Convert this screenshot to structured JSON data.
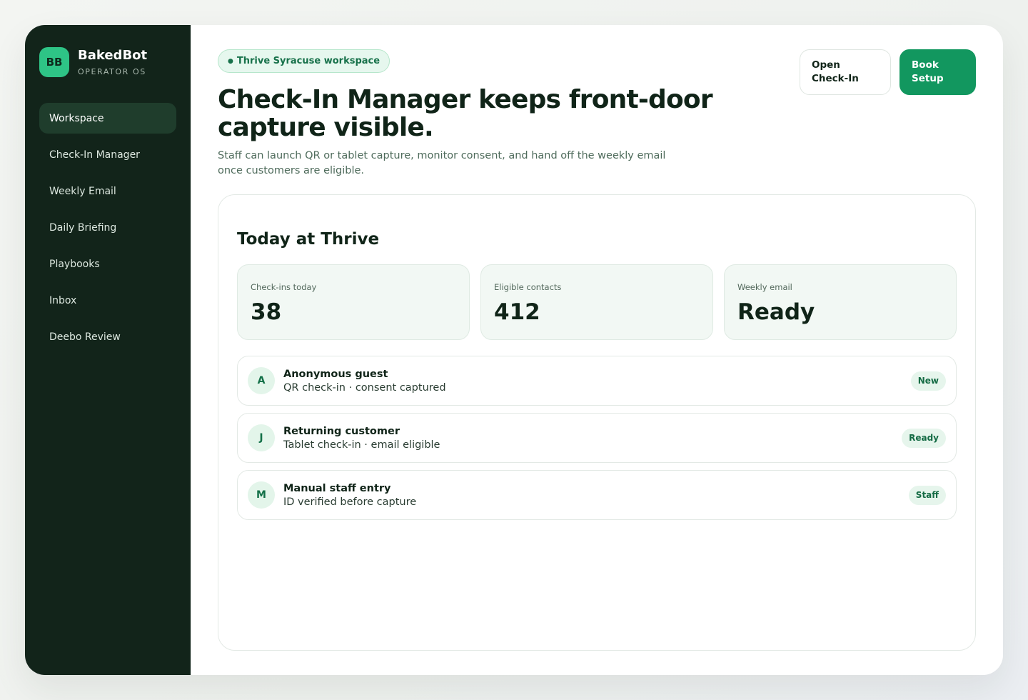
{
  "brand": {
    "mark": "BB",
    "name": "BakedBot",
    "subtitle": "OPERATOR OS"
  },
  "sidebar": {
    "items": [
      {
        "label": "Workspace",
        "active": true
      },
      {
        "label": "Check-In Manager",
        "active": false
      },
      {
        "label": "Weekly Email",
        "active": false
      },
      {
        "label": "Daily Briefing",
        "active": false
      },
      {
        "label": "Playbooks",
        "active": false
      },
      {
        "label": "Inbox",
        "active": false
      },
      {
        "label": "Deebo Review",
        "active": false
      }
    ]
  },
  "header": {
    "workspace_chip": "Thrive Syracuse workspace",
    "title": "Check-In Manager keeps front-door capture visible.",
    "subtitle": "Staff can launch QR or tablet capture, monitor consent, and hand off the weekly email once customers are eligible."
  },
  "actions": {
    "open_checkin": "Open Check-In",
    "book_setup": "Book Setup"
  },
  "panel": {
    "title": "Today at Thrive",
    "stats": [
      {
        "label": "Check-ins today",
        "value": "38"
      },
      {
        "label": "Eligible contacts",
        "value": "412"
      },
      {
        "label": "Weekly email",
        "value": "Ready"
      }
    ],
    "rows": [
      {
        "initial": "A",
        "title": "Anonymous guest",
        "subtitle": "QR check-in · consent captured",
        "badge": "New"
      },
      {
        "initial": "J",
        "title": "Returning customer",
        "subtitle": "Tablet check-in · email eligible",
        "badge": "Ready"
      },
      {
        "initial": "M",
        "title": "Manual staff entry",
        "subtitle": "ID verified before capture",
        "badge": "Staff"
      }
    ]
  },
  "colors": {
    "sidebar_bg": "#12241a",
    "accent": "#12975f",
    "brand_mark": "#2ec486"
  }
}
